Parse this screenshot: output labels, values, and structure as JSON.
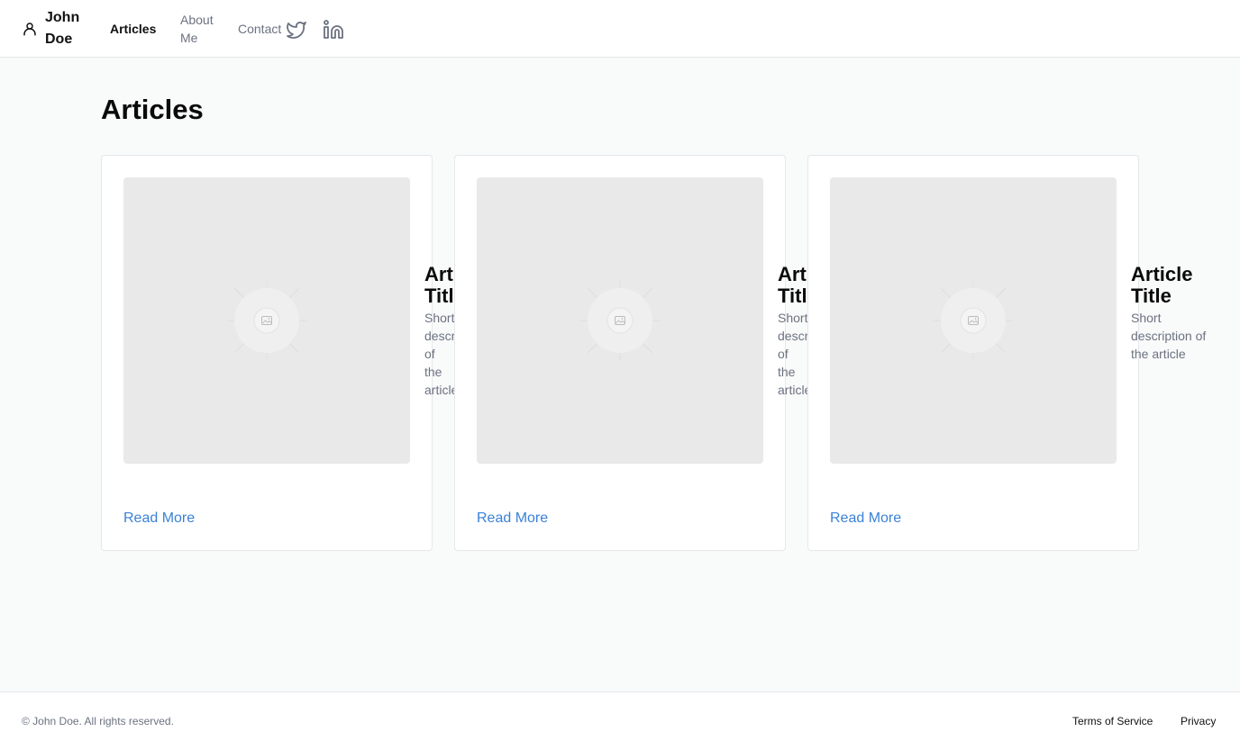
{
  "header": {
    "brand_name": "John Doe",
    "nav": {
      "articles": "Articles",
      "about": "About Me",
      "contact": "Contact"
    }
  },
  "main": {
    "title": "Articles",
    "cards": [
      {
        "title": "Article Title",
        "description": "Short description of the article",
        "link": "Read More"
      },
      {
        "title": "Article Title",
        "description": "Short description of the article",
        "link": "Read More"
      },
      {
        "title": "Article Title",
        "description": "Short description of the article",
        "link": "Read More"
      }
    ]
  },
  "footer": {
    "copyright": "© John Doe. All rights reserved.",
    "terms": "Terms of Service",
    "privacy": "Privacy"
  },
  "colors": {
    "accent": "#3b82d6",
    "muted_text": "#6b7280",
    "background": "#f9fafa",
    "placeholder": "#e9e9e9"
  },
  "icons": {
    "brand": "user-icon",
    "social": [
      "twitter-icon",
      "linkedin-icon"
    ],
    "card_image": "image-placeholder-icon"
  }
}
